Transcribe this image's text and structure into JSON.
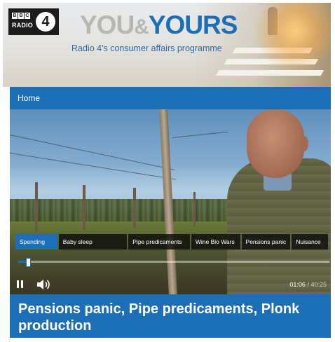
{
  "brand": {
    "logo_bbc_letters": [
      "B",
      "B",
      "C"
    ],
    "logo_radio": "RADIO",
    "logo_number": "4"
  },
  "programme": {
    "title_you": "YOU",
    "title_amp": "&",
    "title_yours": "YOURS",
    "subtitle": "Radio 4's consumer affairs programme"
  },
  "nav": {
    "home_label": "Home"
  },
  "player": {
    "chapters": [
      {
        "label": "Spending",
        "active": true
      },
      {
        "label": "Baby sleep",
        "active": false
      },
      {
        "label": "Pipe predicaments",
        "active": false
      },
      {
        "label": "Wine Bio Wars",
        "active": false
      },
      {
        "label": "Pensions panic",
        "active": false
      },
      {
        "label": "Nuisance",
        "active": false
      }
    ],
    "current_time": "01:06",
    "separator": "/",
    "total_time": "40:25",
    "progress_fraction": 0.027,
    "pause_icon": "pause-icon",
    "volume_icon": "volume-icon"
  },
  "episode": {
    "headline": "Pensions panic, Pipe predicaments, Plonk production"
  },
  "colors": {
    "accent_blue": "#1c6fb6",
    "title_grey": "#b7b6b0"
  }
}
